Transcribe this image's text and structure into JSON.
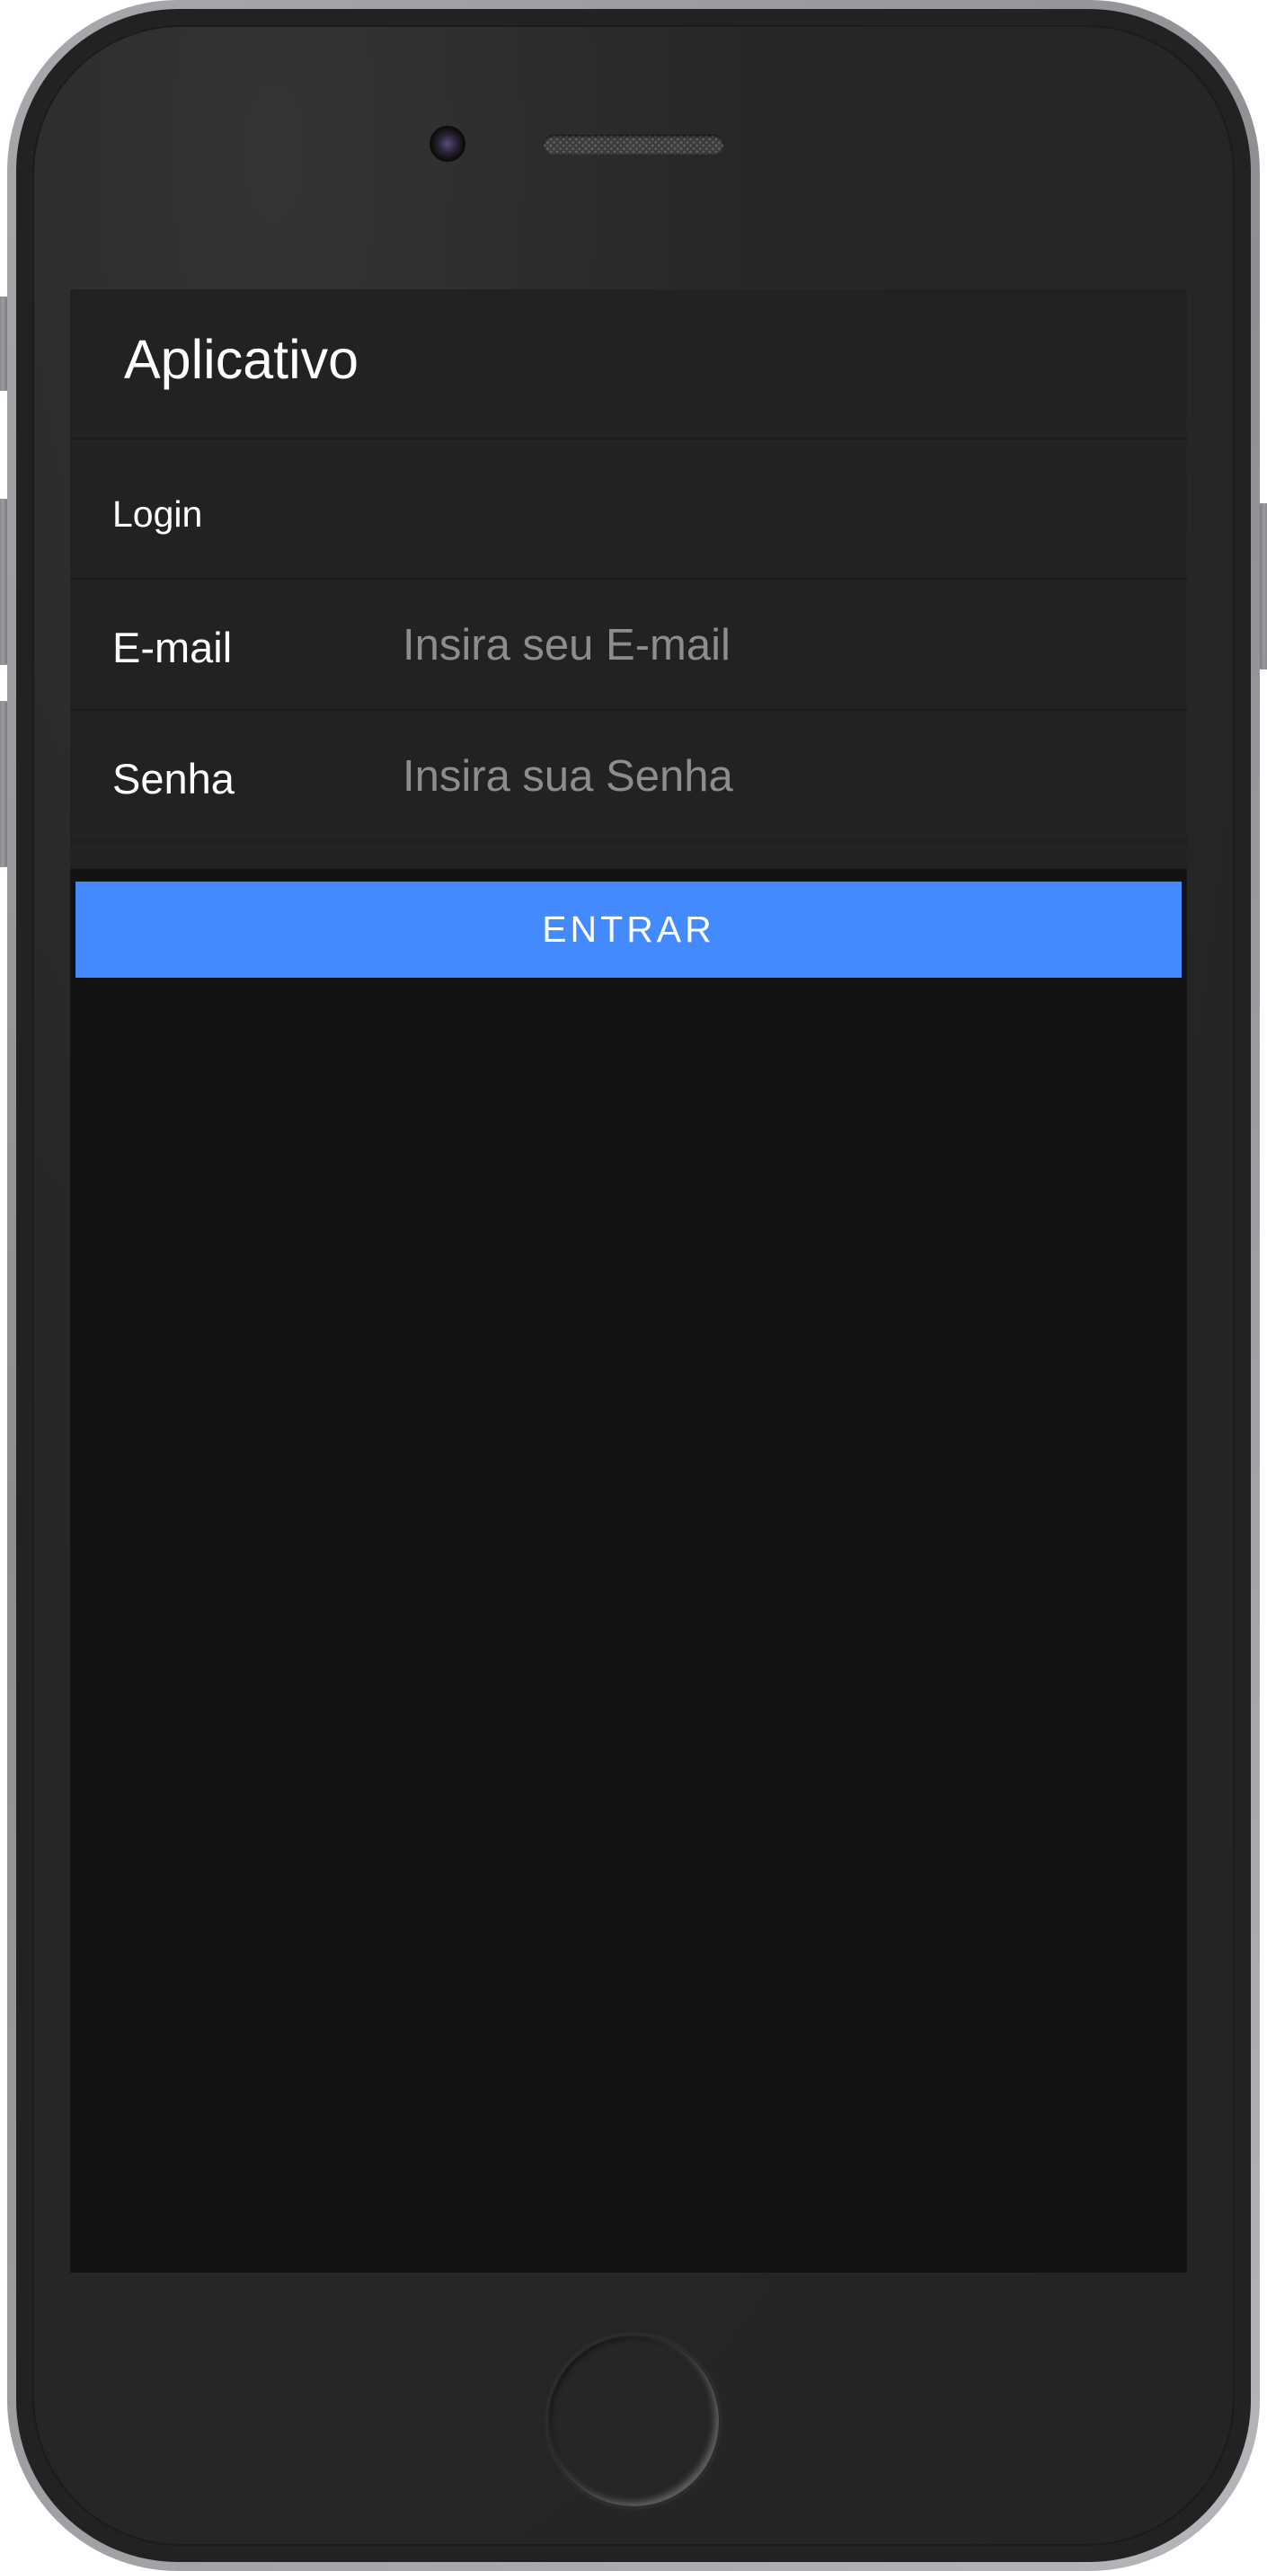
{
  "app": {
    "title": "Aplicativo"
  },
  "login": {
    "title": "Login",
    "email": {
      "label": "E-mail",
      "placeholder": "Insira seu E-mail",
      "value": ""
    },
    "password": {
      "label": "Senha",
      "placeholder": "Insira sua Senha",
      "value": ""
    },
    "submit_label": "ENTRAR"
  },
  "colors": {
    "accent": "#448aff",
    "header_bg": "#222222",
    "screen_bg": "#131313",
    "device_body": "#242425"
  },
  "icons": {
    "camera": "front-camera-icon",
    "speaker": "speaker-grille-icon",
    "home": "home-button-icon"
  }
}
